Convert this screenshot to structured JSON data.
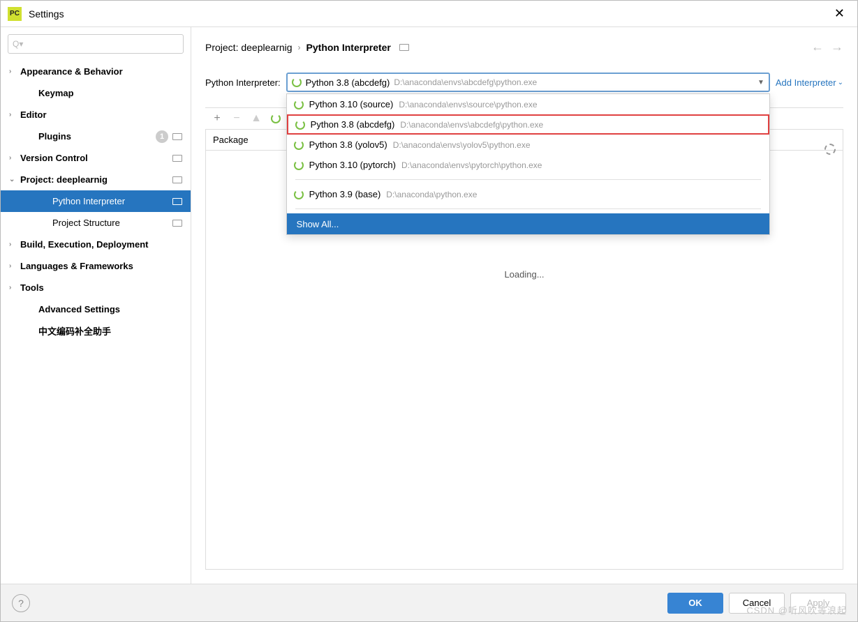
{
  "window": {
    "title": "Settings",
    "app_icon": "PC"
  },
  "search": {
    "placeholder": "Q▾"
  },
  "nav": {
    "items": [
      {
        "label": "Appearance & Behavior",
        "chev": "›",
        "bold": true,
        "badges": []
      },
      {
        "label": "Keymap",
        "chev": "",
        "bold": true,
        "badges": []
      },
      {
        "label": "Editor",
        "chev": "›",
        "bold": true,
        "badges": []
      },
      {
        "label": "Plugins",
        "chev": "",
        "bold": true,
        "badges": [
          "1",
          "proj"
        ]
      },
      {
        "label": "Version Control",
        "chev": "›",
        "bold": true,
        "badges": [
          "proj"
        ]
      },
      {
        "label": "Project: deeplearnig",
        "chev": "⌄",
        "bold": true,
        "badges": [
          "proj"
        ]
      },
      {
        "label": "Python Interpreter",
        "chev": "",
        "bold": false,
        "selected": true,
        "level": 2,
        "badges": [
          "proj"
        ]
      },
      {
        "label": "Project Structure",
        "chev": "",
        "bold": false,
        "level": 2,
        "badges": [
          "proj"
        ]
      },
      {
        "label": "Build, Execution, Deployment",
        "chev": "›",
        "bold": true,
        "badges": []
      },
      {
        "label": "Languages & Frameworks",
        "chev": "›",
        "bold": true,
        "badges": []
      },
      {
        "label": "Tools",
        "chev": "›",
        "bold": true,
        "badges": []
      },
      {
        "label": "Advanced Settings",
        "chev": "",
        "bold": true,
        "badges": []
      },
      {
        "label": "中文编码补全助手",
        "chev": "",
        "bold": true,
        "badges": []
      }
    ]
  },
  "breadcrumb": {
    "items": [
      "Project: deeplearnig",
      "Python Interpreter"
    ]
  },
  "interpreter": {
    "label": "Python Interpreter:",
    "selected": {
      "name": "Python 3.8 (abcdefg)",
      "path": "D:\\anaconda\\envs\\abcdefg\\python.exe"
    },
    "add_link": "Add Interpreter",
    "options": [
      {
        "name": "Python 3.10 (source)",
        "path": "D:\\anaconda\\envs\\source\\python.exe"
      },
      {
        "name": "Python 3.8 (abcdefg)",
        "path": "D:\\anaconda\\envs\\abcdefg\\python.exe",
        "highlighted": true
      },
      {
        "name": "Python 3.8 (yolov5)",
        "path": "D:\\anaconda\\envs\\yolov5\\python.exe"
      },
      {
        "name": "Python 3.10 (pytorch)",
        "path": "D:\\anaconda\\envs\\pytorch\\python.exe"
      }
    ],
    "base_option": {
      "name": "Python 3.9 (base)",
      "path": "D:\\anaconda\\python.exe"
    },
    "show_all": "Show All..."
  },
  "packages": {
    "column_header": "Package",
    "loading": "Loading..."
  },
  "footer": {
    "ok": "OK",
    "cancel": "Cancel",
    "apply": "Apply"
  },
  "watermark": "CSDN @听风吹等浪起"
}
